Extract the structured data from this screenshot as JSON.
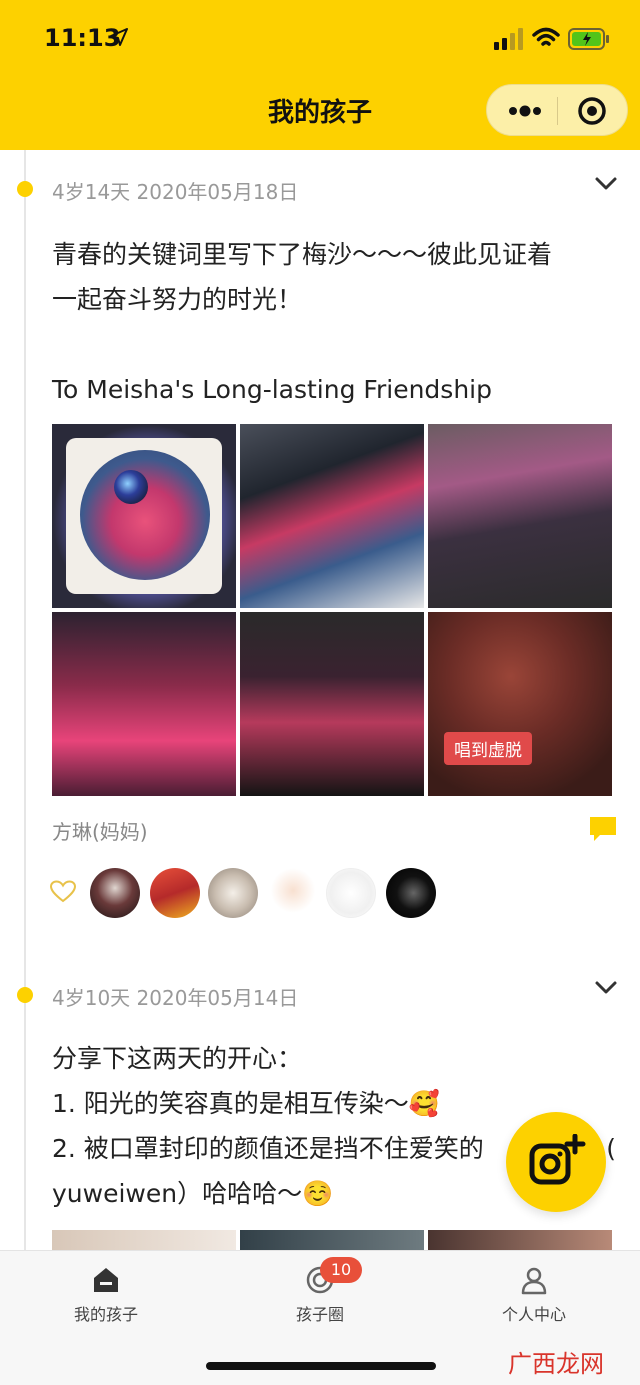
{
  "status_bar": {
    "time": "11:13"
  },
  "header": {
    "title": "我的孩子"
  },
  "colors": {
    "brand_yellow": "#FDD100",
    "badge_red": "#e8503a",
    "watermark_red": "#d9342b"
  },
  "posts": [
    {
      "meta": "4岁14天 2020年05月18日",
      "text_line1": "青春的关键词里写下了梅沙～～～彼此见证着",
      "text_line2": "一起奋斗努力的时光！",
      "text_line3": "To Meisha's Long-lasting Friendship",
      "photo_tag": "唱到虚脱",
      "author": "方琳(妈妈)"
    },
    {
      "meta": "4岁10天 2020年05月14日",
      "text_line1": "分享下这两天的开心：",
      "text_line2": "1. 阳光的笑容真的是相互传染～🥰",
      "text_line3": "2. 被口罩封印的颜值还是挡不住爱笑的",
      "text_line3_end": "(",
      "text_line4": "yuweiwen）哈哈哈～☺️"
    }
  ],
  "tabbar": {
    "home_label": "我的孩子",
    "circle_label": "孩子圈",
    "circle_badge": "10",
    "me_label": "个人中心"
  },
  "watermark": "广西龙网",
  "icons": [
    "location-arrow-icon",
    "signal-icon",
    "wifi-icon",
    "battery-icon",
    "more-icon",
    "target-icon",
    "chevron-down-icon",
    "comment-icon",
    "heart-icon",
    "camera-add-icon",
    "home-icon",
    "circle-icon",
    "person-icon"
  ]
}
